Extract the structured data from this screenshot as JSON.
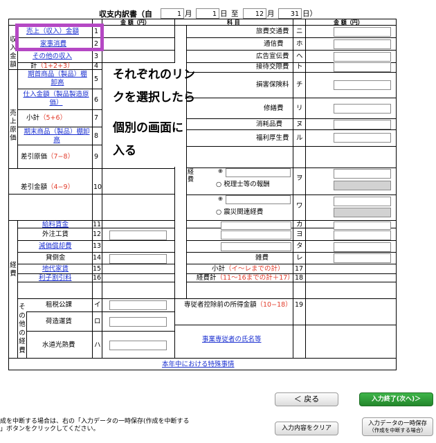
{
  "header": {
    "title": "収支内訳書（自",
    "month_start": "1",
    "month_unit": "月",
    "day_start": "1",
    "day_unit": "日",
    "to": "至",
    "month_end": "12",
    "day_end": "31",
    "close_paren": "日）"
  },
  "col_headers": {
    "amount": "金 額（円）",
    "subject": "科 目",
    "amount_right": "金 額（円）"
  },
  "left": {
    "group_income": "収入金額",
    "group_cost": "売上原価",
    "group_expense": "経費",
    "group_other": "その他の経費",
    "sales": "売上（収入）金額",
    "household": "家事消費",
    "other_income": "その他の収入",
    "total_label": "計",
    "total_formula": "（1+2+3）",
    "opening_inv": "期首商品（製品）棚卸高",
    "purchase": "仕入金額（製品製造原価）",
    "subtotal_label": "小計",
    "subtotal_formula": "（5+6）",
    "closing_inv": "期末商品（製品）棚卸高",
    "cogs_label": "差引原価",
    "cogs_formula": "（7−8）",
    "gross_label": "差引金額",
    "gross_formula": "（4−9）",
    "wages": "給料賃金",
    "outsourcing": "外注工賃",
    "depreciation": "減価償却費",
    "bad_debt": "貸倒金",
    "rent": "地代家賃",
    "interest": "利子割引料",
    "taxes": "租税公課",
    "freight": "荷造運賃",
    "utilities": "水道光熱費",
    "nums": [
      "1",
      "2",
      "3",
      "4",
      "5",
      "6",
      "7",
      "8",
      "9",
      "10",
      "11",
      "12",
      "13",
      "14",
      "15",
      "16",
      "イ",
      "ロ",
      "ハ"
    ]
  },
  "right": {
    "travel": "旅費交通費",
    "comm": "通信費",
    "ads": "広告宣伝費",
    "entertain": "接待交際費",
    "insurance": "損害保険料",
    "repairs": "修繕費",
    "supplies": "消耗品費",
    "welfare": "福利厚生費",
    "keihi_label": "経費",
    "tax_accountant": "○ 税理士等の報酬",
    "disaster": "○ 震災関連経費",
    "misc": "雑費",
    "subtotal_label": "小計",
    "subtotal_formula": "（イ～レまでの計）",
    "total_label": "経費計",
    "total_formula": "（11～16までの計＋17）",
    "pre_deduction_label": "専従者控除前の所得金額",
    "pre_deduction_formula": "（10−18）",
    "employee_list_link": "事業専従者の氏名等",
    "nums": [
      "ニ",
      "ホ",
      "ヘ",
      "ト",
      "チ",
      "リ",
      "ヌ",
      "ル",
      "ヲ",
      "ワ",
      "カ",
      "ヨ",
      "タ",
      "レ",
      "17",
      "18",
      "19"
    ]
  },
  "special_link": "本年中における特殊事情",
  "callout": {
    "line1": "それぞれのリン",
    "line2": "クを選択したら",
    "line3": "個別の画面に",
    "line4": "入る"
  },
  "footer": {
    "note_line1": "成を中断する場合は、右の「入力データの一時保存(作成を中断する",
    "note_line2": "」ボタンをクリックしてください。",
    "back": "＜ 戻る",
    "finish": "入力終了(次へ)＞",
    "clear": "入力内容をクリア",
    "save_line1": "入力データの一時保存",
    "save_line2": "（作成を中断する場合）"
  },
  "colors": {
    "link": "#1a2fd0",
    "formula": "#e23b2a",
    "highlight": "#b548c4",
    "finish_button": "#2e9a34"
  }
}
